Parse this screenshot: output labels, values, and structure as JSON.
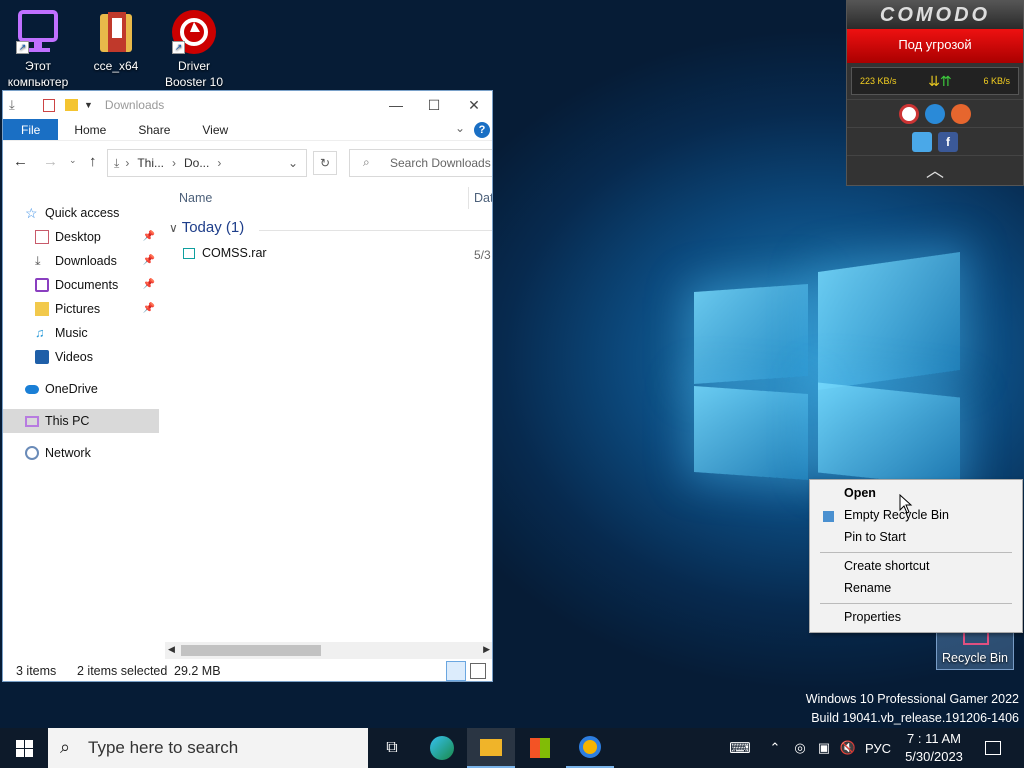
{
  "desktop": {
    "icons": [
      {
        "label": "Этот компьютер"
      },
      {
        "label": "cce_x64"
      },
      {
        "label": "Driver Booster 10"
      },
      {
        "label": "Recycle Bin"
      }
    ],
    "watermark_line1": "Windows 10 Professional Gamer 2022",
    "watermark_line2": "Build 19041.vb_release.191206-1406"
  },
  "explorer": {
    "title": "Downloads",
    "ribbon_tabs": [
      "File",
      "Home",
      "Share",
      "View"
    ],
    "breadcrumb": [
      "Thi...",
      "Do..."
    ],
    "search_placeholder": "Search Downloads",
    "column_name": "Name",
    "column_date": "Dat",
    "nav": [
      {
        "label": "Quick access",
        "pinned": false
      },
      {
        "label": "Desktop",
        "pinned": true
      },
      {
        "label": "Downloads",
        "pinned": true
      },
      {
        "label": "Documents",
        "pinned": true
      },
      {
        "label": "Pictures",
        "pinned": true
      },
      {
        "label": "Music",
        "pinned": false
      },
      {
        "label": "Videos",
        "pinned": false
      },
      {
        "label": "OneDrive",
        "pinned": false
      },
      {
        "label": "This PC",
        "pinned": false,
        "selected": true
      },
      {
        "label": "Network",
        "pinned": false
      }
    ],
    "group_label": "Today (1)",
    "files": [
      {
        "name": "COMSS.rar",
        "date": "5/3"
      }
    ],
    "status_items": "3 items",
    "status_selected": "2 items selected",
    "status_size": "29.2 MB"
  },
  "comodo": {
    "brand": "COMODO",
    "status": "Под угрозой",
    "speed_down": "223 KB/s",
    "speed_up": "6 KB/s"
  },
  "context_menu": {
    "items": [
      "Open",
      "Empty Recycle Bin",
      "Pin to Start",
      "Create shortcut",
      "Rename",
      "Properties"
    ]
  },
  "taskbar": {
    "search_placeholder": "Type here to search",
    "language": "РУС",
    "time": "7 : 11 AM",
    "date": "5/30/2023"
  },
  "colors": {
    "accent": "#1a6fc4",
    "comodo_red": "#d40000"
  }
}
